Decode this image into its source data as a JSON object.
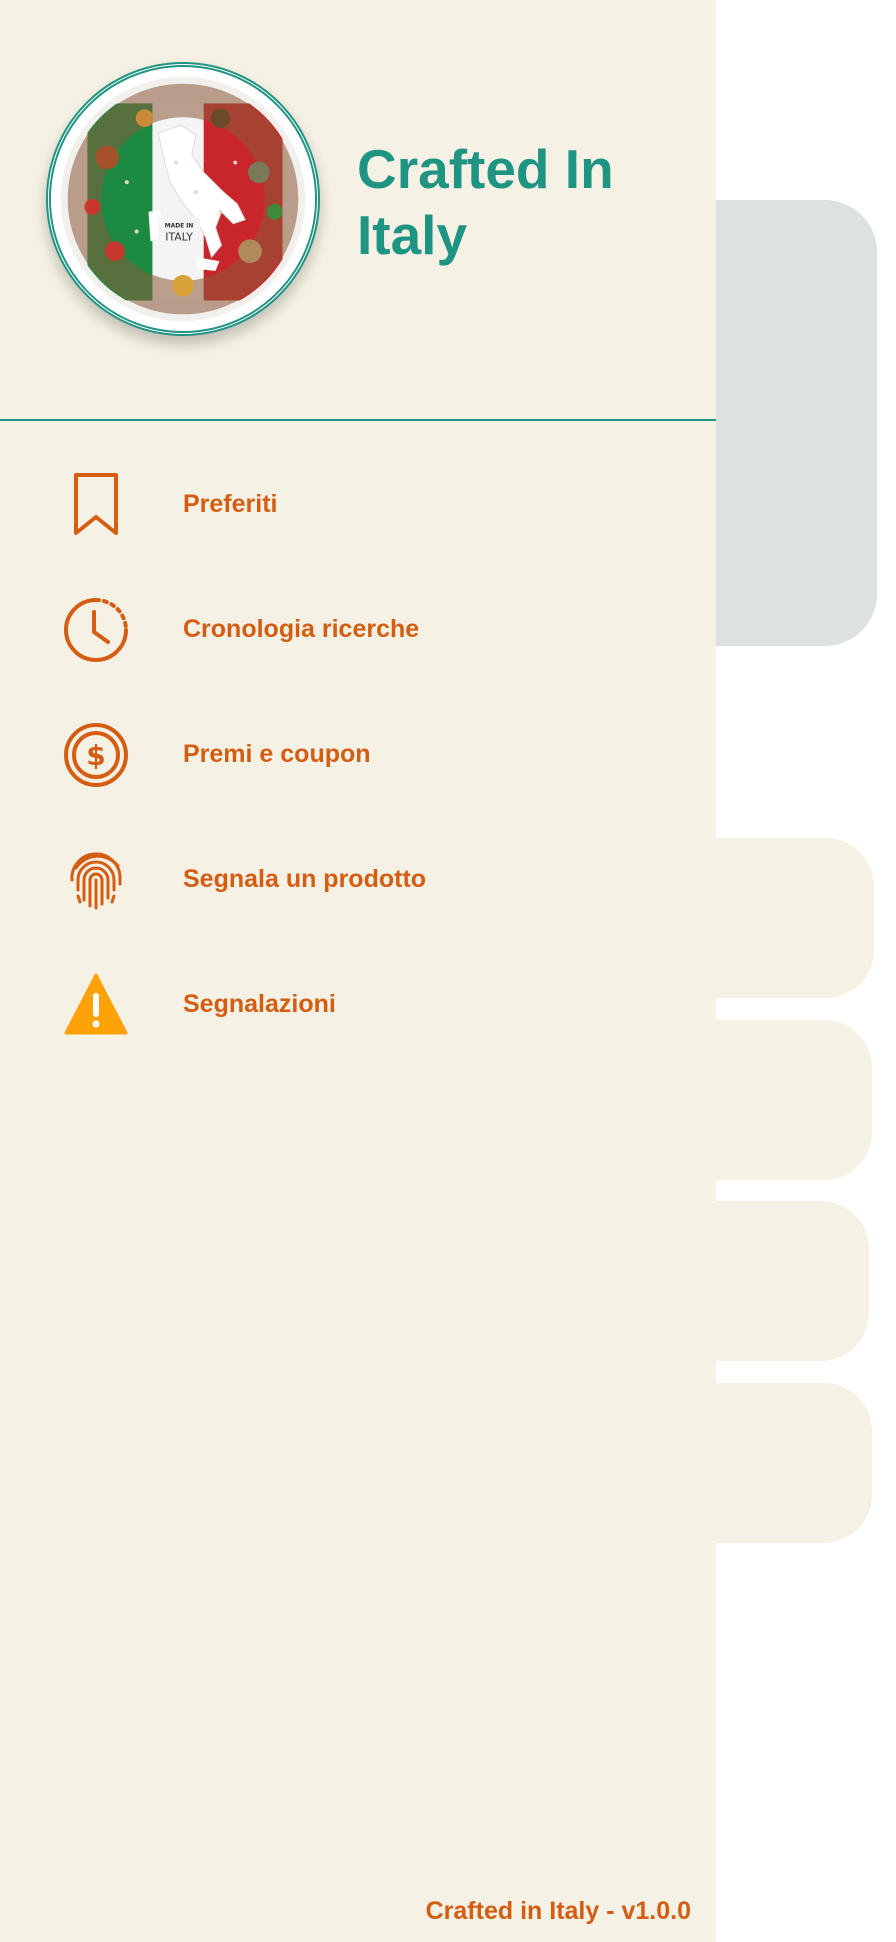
{
  "app": {
    "title": "Crafted In Italy",
    "accent_color": "#1f9483",
    "menu_color": "#d45d12",
    "warning_color": "#ffa20a",
    "drawer_background": "#f5f1e4"
  },
  "logo": {
    "icon": "made-in-italy-logo",
    "caption_top": "MADE IN",
    "caption_bottom": "ITALY"
  },
  "menu": {
    "items": [
      {
        "label": "Preferiti",
        "icon": "bookmark-icon"
      },
      {
        "label": "Cronologia ricerche",
        "icon": "history-clock-icon"
      },
      {
        "label": "Premi e coupon",
        "icon": "dollar-coin-icon"
      },
      {
        "label": "Segnala un prodotto",
        "icon": "fingerprint-icon"
      },
      {
        "label": "Segnalazioni",
        "icon": "warning-icon"
      }
    ]
  },
  "footer": {
    "version": "Crafted in Italy - v1.0.0"
  }
}
